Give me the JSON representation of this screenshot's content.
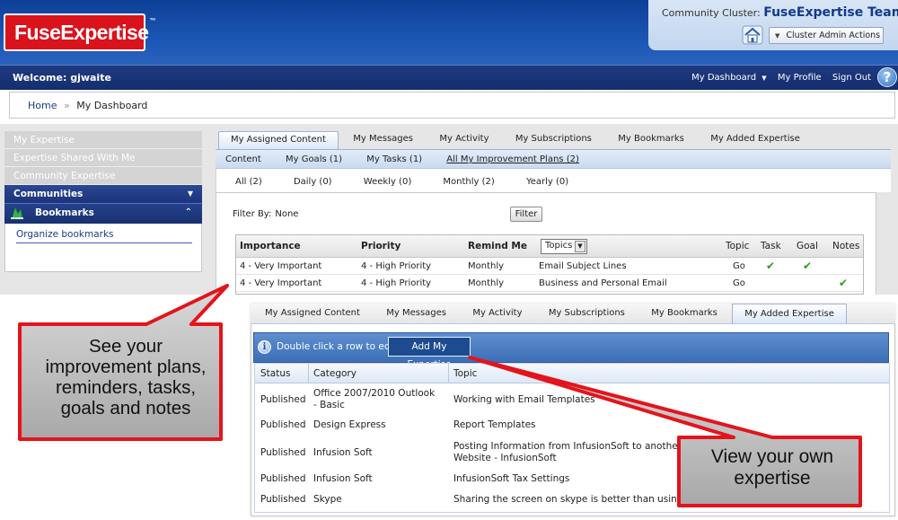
{
  "brand": {
    "logo_text": "FuseExpertise",
    "logo_mark": "™",
    "logo_color": "#d9121c"
  },
  "cluster": {
    "label": "Community Cluster:",
    "name": "FuseExpertise Team",
    "admin_button": "Cluster Admin Actions"
  },
  "welcome": "Welcome: gjwaite",
  "top_nav": [
    "My Dashboard",
    "My Profile",
    "Sign Out"
  ],
  "help_glyph": "?",
  "breadcrumb": {
    "home": "Home",
    "separator": "»",
    "current": "My Dashboard"
  },
  "sidebar": {
    "links": [
      "My Expertise",
      "Expertise Shared With Me",
      "Community Expertise"
    ],
    "communities": "Communities",
    "bookmarks": "Bookmarks",
    "organize": "Organize bookmarks"
  },
  "main_tabs": [
    "My Assigned Content",
    "My Messages",
    "My Activity",
    "My Subscriptions",
    "My Bookmarks",
    "My Added Expertise"
  ],
  "sub_nav": [
    "Content",
    "My Goals (1)",
    "My Tasks (1)",
    "All My Improvement Plans (2)"
  ],
  "freq_filters": [
    "All (2)",
    "Daily (0)",
    "Weekly (0)",
    "Monthly (2)",
    "Yearly (0)"
  ],
  "filter": {
    "label": "Filter By:",
    "value": "None",
    "button": "Filter"
  },
  "plan_table": {
    "headers": {
      "importance": "Importance",
      "priority": "Priority",
      "remind": "Remind Me",
      "topics": "Topics",
      "topic": "Topic",
      "task": "Task",
      "goal": "Goal",
      "notes": "Notes"
    },
    "rows": [
      {
        "importance": "4 - Very Important",
        "priority": "4 - High Priority",
        "remind": "Monthly",
        "topic_name": "Email Subject Lines",
        "go": "Go",
        "task": "✔",
        "goal": "✔",
        "notes": ""
      },
      {
        "importance": "4 - Very Important",
        "priority": "4 - High Priority",
        "remind": "Monthly",
        "topic_name": "Business and Personal Email",
        "go": "Go",
        "task": "",
        "goal": "",
        "notes": "✔"
      }
    ]
  },
  "bottom": {
    "tabs": [
      "My Assigned Content",
      "My Messages",
      "My Activity",
      "My Subscriptions",
      "My Bookmarks",
      "My Added Expertise"
    ],
    "hint": "Double click a row to edit.",
    "add_button": "Add My Expertise",
    "headers": {
      "status": "Status",
      "category": "Category",
      "topic": "Topic"
    },
    "rows": [
      {
        "status": "Published",
        "category": "Office 2007/2010 Outlook - Basic",
        "topic": "Working with Email Templates"
      },
      {
        "status": "Published",
        "category": "Design Express",
        "topic": "Report Templates"
      },
      {
        "status": "Published",
        "category": "Infusion Soft",
        "topic": "Posting Information from InfusionSoft to another Website - InfusionSoft"
      },
      {
        "status": "Published",
        "category": "Infusion Soft",
        "topic": "InfusionSoft Tax Settings"
      },
      {
        "status": "Published",
        "category": "Skype",
        "topic": "Sharing the screen on skype is better than using GlassBoard"
      }
    ]
  },
  "callouts": {
    "plans": [
      "See your",
      "improvement plans,",
      "reminders, tasks,",
      "goals and notes"
    ],
    "expertise": [
      "View your own",
      "expertise"
    ],
    "border_color": "#e3141c"
  }
}
